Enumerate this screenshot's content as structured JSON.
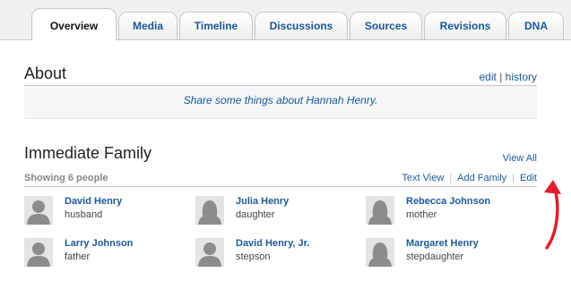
{
  "tabs": [
    {
      "label": "Overview",
      "active": true
    },
    {
      "label": "Media"
    },
    {
      "label": "Timeline"
    },
    {
      "label": "Discussions"
    },
    {
      "label": "Sources"
    },
    {
      "label": "Revisions"
    },
    {
      "label": "DNA"
    }
  ],
  "about": {
    "title": "About",
    "edit_label": "edit",
    "separator": "|",
    "history_label": "history",
    "prompt": "Share some things about Hannah Henry."
  },
  "family": {
    "title": "Immediate Family",
    "view_all": "View All",
    "showing": "Showing 6 people",
    "actions": [
      "Text View",
      "Add Family",
      "Edit"
    ],
    "members": [
      {
        "name": "David Henry",
        "relation": "husband"
      },
      {
        "name": "Julia Henry",
        "relation": "daughter"
      },
      {
        "name": "Rebecca Johnson",
        "relation": "mother"
      },
      {
        "name": "Larry Johnson",
        "relation": "father"
      },
      {
        "name": "David Henry, Jr.",
        "relation": "stepson"
      },
      {
        "name": "Margaret Henry",
        "relation": "stepdaughter"
      }
    ]
  },
  "colors": {
    "link": "#1a5a9b",
    "annotation_arrow": "#e0202a"
  },
  "icons": {
    "avatar_male": "person-silhouette-icon",
    "avatar_female": "person-silhouette-female-icon",
    "annotation": "curved-arrow-icon"
  }
}
